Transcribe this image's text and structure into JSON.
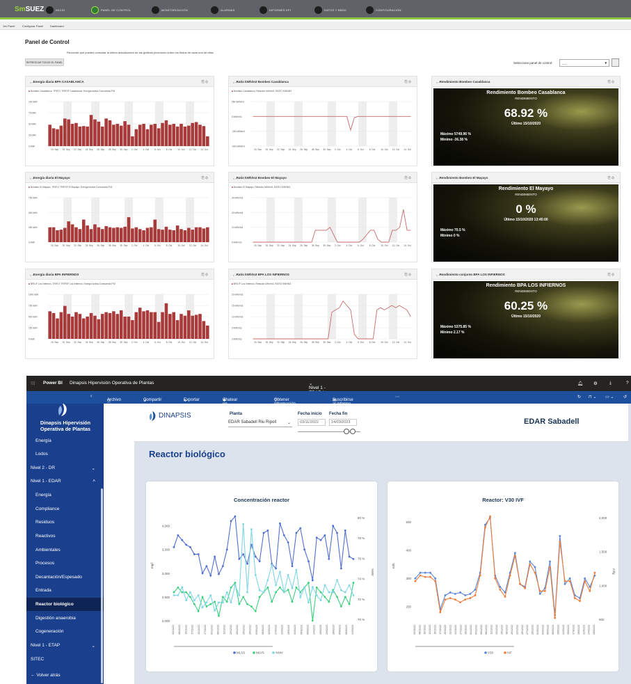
{
  "topnav": {
    "logo_a": "Sm",
    "logo_b": "SUEZ",
    "items": [
      "INICIO",
      "PANEL DE CONTROL",
      "MONITORIZACIÓN",
      "ALARMAS",
      "INFORMES KPI",
      "DATOS Y BBDD",
      "CONFIGURACIÓN"
    ]
  },
  "subnav": [
    "Ver Panel",
    "Configurar Panel",
    "Dashboard"
  ],
  "page": {
    "title": "Panel de Control",
    "info": "Recuerde que puedes consultar la última actualización de las gráficas pinchando sobre los títulos de cada una de ellas.",
    "refresh": "REFRESCAR TODOS EL PANEL",
    "select_label": "Seleccione panel de control:",
    "select_value": "-----"
  },
  "colors": {
    "bar": "#a93a3a",
    "line": "#c86a6a",
    "accent": "#8dc63f"
  },
  "panels": [
    {
      "title": ".Energía diaria BPA CASABLANCA",
      "legend": "Bombeo Casablanca. TRIFLY TRIFSF Casablanca. Energía Activa Consumida P.M"
    },
    {
      "title": ".Ratio kWh/m3 Bombeo Casablanca",
      "legend": "Bombeo Casablanca. Relación kWh/m3. RATIO KWHM3"
    },
    {
      "title": ".Rendimiento Bombeo Casablanca"
    },
    {
      "title": ".Energía diaria El Mayayo",
      "legend": "Bombeo El Mayayo. TRIFLY TRIFSF El Mayayo. Energía Activa Consumida P.M"
    },
    {
      "title": ".Ratio kWh/m3 Bombeo El Mayayo",
      "legend": "Bombeo El Mayayo. Relación kWh/m3. RATIO KWHM3"
    },
    {
      "title": ".Rendimiento Bombeo El Mayayo"
    },
    {
      "title": ".Energía diaria BPA INFIERNOS",
      "legend": "BPA IF Los Infiernos. TRIFLY TRIFSF Los Infiernos. Energía Activa Consumida P.M"
    },
    {
      "title": ".Ratio kWh/m3 BPA LOS INFIERNOS",
      "legend": "BPA IF Los Infiernos. Relación kWh/m3. RATIO KWHM3"
    },
    {
      "title": ".Rendimiento conjunto BPA LOS INFIERNOS"
    }
  ],
  "kpis": [
    {
      "title": "Rendimiento Bombeo Casablanca",
      "sub": "RENDIMIENTO",
      "value": "68.92 %",
      "ultimo": "Último 15/10/2020",
      "max": "Máximo 5749.96 %",
      "min": "Mínimo -36.38 %"
    },
    {
      "title": "Rendimiento El Mayayo",
      "sub": "RENDIMIENTO",
      "value": "0 %",
      "ultimo": "Último 15/10/2020 13:45:00",
      "max": "Máximo 70.5 %",
      "min": "Mínimo 0 %"
    },
    {
      "title": "Rendimiento BPA LOS INFIERNOS",
      "sub": "RENDIMIENTO",
      "value": "60.25 %",
      "ultimo": "Último 15/10/2020",
      "max": "Máximo 5375.85 %",
      "min": "Mínimo 2.17 %"
    }
  ],
  "small_xticks": [
    "15. Sep",
    "20. Sep",
    "22. Sep",
    "24. Sep",
    "26. Sep",
    "28. Sep",
    "30. Sep",
    "2. Oct",
    "4. Oct",
    "6. Oct",
    "8. Oct",
    "10. Oct",
    "12. Oct",
    "14. Oct"
  ],
  "small_charts": {
    "e1": {
      "yticks": [
        "100 kWh",
        "75 kWh",
        "50 kWh",
        "25 kWh",
        "0 kWh"
      ],
      "ymax": 100,
      "values": [
        48,
        40,
        38,
        46,
        62,
        60,
        50,
        52,
        44,
        45,
        44,
        70,
        60,
        55,
        44,
        62,
        58,
        48,
        50,
        46,
        56,
        48,
        22,
        38,
        48,
        50,
        38,
        48,
        50,
        40,
        52,
        58,
        48,
        50,
        44,
        50,
        44,
        46,
        52,
        54,
        48,
        45,
        22
      ]
    },
    "r1": {
      "yticks": [
        "250 kWh/m3",
        "0 kWh/m3",
        "-250 kWh/m3",
        "-500 kWh/m3"
      ],
      "ymin": -500,
      "ymax": 250,
      "values": [
        0,
        0,
        0,
        0,
        0,
        0,
        0,
        0,
        0,
        0,
        0,
        0,
        0,
        0,
        0,
        0,
        0,
        0,
        0,
        0,
        0,
        0,
        0,
        0,
        0,
        0,
        -230,
        -20,
        0,
        0,
        0,
        0,
        0,
        0,
        0,
        0,
        0,
        0,
        0,
        0,
        0,
        0,
        0
      ]
    },
    "e2": {
      "yticks": [
        "750 kWh",
        "500 kWh",
        "250 kWh",
        "0 kWh"
      ],
      "ymax": 750,
      "values": [
        250,
        250,
        200,
        210,
        240,
        350,
        300,
        250,
        220,
        380,
        280,
        220,
        300,
        250,
        220,
        270,
        250,
        240,
        250,
        240,
        260,
        420,
        230,
        250,
        220,
        200,
        240,
        250,
        380,
        220,
        210,
        260,
        210,
        200,
        280,
        220,
        200,
        240,
        210,
        250,
        250,
        230,
        250
      ]
    },
    "r2": {
      "yticks": [
        "30 kWh/m3",
        "20 kWh/m3",
        "10 kWh/m3",
        "0 kWh/m3"
      ],
      "ymax": 30,
      "values": [
        0,
        0,
        0,
        0,
        0,
        0,
        0,
        0,
        0,
        0,
        0,
        0,
        0,
        0,
        0,
        0,
        0,
        8,
        8,
        8,
        8,
        10,
        5,
        0,
        0,
        0,
        0,
        0,
        0,
        0,
        2,
        5,
        8,
        8,
        2,
        0,
        0,
        0,
        8,
        8,
        10,
        22,
        8,
        8
      ]
    },
    "e3": {
      "yticks": [
        "1000 kWh",
        "750 kWh",
        "500 kWh",
        "250 kWh",
        "0 kWh"
      ],
      "ymax": 1000,
      "values": [
        620,
        580,
        460,
        600,
        740,
        560,
        500,
        600,
        560,
        460,
        500,
        580,
        520,
        440,
        560,
        600,
        580,
        620,
        560,
        640,
        500,
        500,
        420,
        600,
        700,
        620,
        640,
        600,
        600,
        380,
        600,
        800,
        560,
        600,
        420,
        560,
        520,
        640,
        520,
        540,
        560,
        400,
        300
      ]
    },
    "r3": {
      "yticks": [
        "20 kWh/m3",
        "15 kWh/m3",
        "10 kWh/m3",
        "5 kWh/m3",
        "0 kWh/m3"
      ],
      "ymax": 20,
      "values": [
        0,
        0,
        0,
        0,
        0,
        0,
        0,
        0,
        0,
        0,
        0,
        0,
        0,
        0,
        0,
        0,
        0,
        0,
        0,
        0,
        0,
        12,
        13,
        14,
        17,
        15,
        13,
        2,
        0,
        0,
        0,
        0,
        0,
        13,
        14,
        13,
        14,
        15,
        14,
        15,
        14,
        13,
        10
      ]
    }
  },
  "pbi": {
    "app": "Power BI",
    "report": "Dinapsis Hipervisión Operativa de Plantas",
    "page_label": "Nivel 1 - EDAR  |  Datos actualizados el 14/3/23",
    "toolbar": [
      "Archivo",
      "Compartir",
      "Exportar",
      "Chatear en Teams",
      "Obtener información",
      "Suscribirse al informe"
    ],
    "sidebar_title": "Dinapsis Hipervisión Operativa de Plantas",
    "sidebar": [
      "Energía",
      "Lodos",
      "Nivel 2 - DR",
      "Nivel 1 - EDAR",
      "Energía",
      "Compliance",
      "Residuos",
      "Reactivos",
      "Ambientales",
      "Procesos",
      "Decantación/Espesado",
      "Entrada",
      "Reactor biológico",
      "Digestión anaerobia",
      "Cogeneración",
      "Nivel 1 - ETAP",
      "SITEC",
      "Volver atrás"
    ],
    "brand": "DINAPSIS",
    "planta_label": "Planta",
    "planta_value": "EDAR Sabadell Riu Ripoll",
    "fi_label": "Fecha inicio",
    "ff_label": "Fecha fin",
    "fi_value": "03/11/2022",
    "ff_value": "14/03/2023",
    "site": "EDAR Sabadell",
    "section": "Reactor biológico"
  },
  "chart_data": [
    {
      "type": "line",
      "title": "Concentración reactor",
      "ylabel": "mg/l",
      "y2label": "%MV",
      "yticks": [
        "4,000",
        "3,500",
        "3,000",
        "2,500",
        "2,000"
      ],
      "y2ticks": [
        "80 %",
        "78 %",
        "76 %",
        "74 %",
        "72 %",
        "70 %"
      ],
      "ylim": [
        2000,
        4200
      ],
      "x": [
        "03/11/22",
        "06/11/22",
        "08/11/22",
        "10/11/22",
        "13/11/22",
        "15/11/22",
        "17/11/22",
        "20/11/22",
        "22/11/22",
        "24/11/22",
        "27/11/22",
        "29/11/22",
        "01/12/22",
        "04/12/22",
        "06/12/22",
        "08/12/22",
        "11/12/22",
        "13/12/22",
        "15/12/22",
        "18/12/22",
        "20/12/22",
        "22/12/22",
        "25/12/22",
        "27/12/22",
        "29/12/22",
        "01/01/23",
        "03/01/23",
        "05/01/23",
        "08/01/23",
        "10/01/23",
        "12/01/23",
        "15/01/23",
        "17/01/23",
        "19/01/23",
        "22/01/23",
        "24/01/23",
        "26/01/23",
        "29/01/23",
        "31/01/23",
        "02/02/23",
        "05/02/23",
        "07/02/23",
        "09/02/23",
        "12/02/23",
        "14/02/23",
        "16/02/23",
        "19/02/23",
        "21/02/23",
        "23/02/23",
        "26/02/23",
        "28/02/23",
        "02/03/23",
        "05/03/23",
        "07/03/23",
        "09/03/23",
        "12/03/23",
        "14/03/23"
      ],
      "series": [
        {
          "name": "MLSS",
          "color": "#4f6fd1",
          "values": [
            3550,
            3800,
            3700,
            3600,
            3550,
            3400,
            3400,
            3000,
            3150,
            2950,
            3350,
            2980,
            3150,
            3500,
            4100,
            4200,
            3300,
            3400,
            3200,
            3600,
            3350,
            3250,
            3850,
            3900,
            3200,
            3100,
            4050,
            3800,
            3650,
            3150,
            3850,
            3950,
            3500,
            3250,
            2850,
            3750,
            3700,
            3800,
            3300,
            4000,
            3850,
            3100,
            3900,
            3350,
            3300
          ]
        },
        {
          "name": "MLVS",
          "color": "#3ccf7e",
          "values": [
            2600,
            2700,
            2600,
            2600,
            2500,
            2350,
            2200,
            2500,
            2300,
            2350,
            2400,
            2100,
            2500,
            2400,
            2700,
            2800,
            2350,
            2500,
            2350,
            2300,
            2200,
            2500,
            2600,
            2700,
            2400,
            2600,
            2700,
            2600,
            2650,
            2400,
            2700,
            2600,
            2700,
            2800,
            2000,
            2700,
            2600,
            2500,
            2400,
            2650,
            2500,
            2300,
            2500,
            2350,
            2800
          ]
        },
        {
          "name": "%MV",
          "color": "#7fd6e6",
          "values": [
            72.5,
            72.5,
            73.3,
            72.0,
            72.8,
            72.0,
            72.5,
            71.3,
            71.8,
            72.5,
            71.0,
            71.8,
            71.8,
            72.8,
            71.8,
            73.5,
            72.5,
            79.5,
            72.8,
            79.0,
            74.5,
            73.0,
            72.8,
            74.0,
            75.5,
            73.5,
            74.8,
            72.8,
            74.5,
            73.2,
            75.0,
            72.3,
            73.3,
            71.8,
            73.3,
            72.5,
            72.0,
            73.5,
            72.8,
            72.8,
            74.0,
            73.0,
            72.8,
            73.5,
            72.5
          ]
        }
      ]
    },
    {
      "type": "line",
      "title": "Reactor: V30 IVF",
      "ylabel": "ml/L",
      "y2label": "ml/g",
      "yticks": [
        "500",
        "400",
        "300",
        "200"
      ],
      "y2ticks": [
        "2,000",
        "1,500",
        "1,000",
        "500"
      ],
      "ylim": [
        150,
        520
      ],
      "x": [
        "03/11/22",
        "08/11/22",
        "10/11/22",
        "13/11/22",
        "15/11/22",
        "17/11/22",
        "20/11/22",
        "22/11/22",
        "24/11/22",
        "27/11/22",
        "29/11/22",
        "01/12/22",
        "04/12/22",
        "06/12/22",
        "08/12/22",
        "11/12/22",
        "13/12/22",
        "15/12/22",
        "18/12/22",
        "20/12/22",
        "22/12/22",
        "25/12/22",
        "27/12/22",
        "29/12/22",
        "01/01/23",
        "03/01/23",
        "05/01/23",
        "08/01/23",
        "10/01/23",
        "12/01/23",
        "15/01/23",
        "17/01/23",
        "19/01/23",
        "22/01/23",
        "24/01/23",
        "26/01/23"
      ],
      "series": [
        {
          "name": "V30",
          "color": "#5b86d8",
          "values": [
            300,
            320,
            320,
            320,
            300,
            190,
            240,
            250,
            245,
            250,
            240,
            245,
            260,
            320,
            490,
            515,
            310,
            270,
            250,
            320,
            390,
            280,
            270,
            360,
            340,
            245,
            265,
            360,
            170,
            450,
            280,
            300,
            240,
            230,
            300,
            270,
            310
          ]
        },
        {
          "name": "IVF",
          "color": "#ee7d3a",
          "values": [
            290,
            310,
            305,
            305,
            290,
            180,
            225,
            230,
            225,
            215,
            225,
            230,
            240,
            310,
            480,
            520,
            300,
            260,
            235,
            310,
            380,
            280,
            265,
            350,
            320,
            255,
            255,
            340,
            160,
            430,
            290,
            290,
            230,
            220,
            290,
            255,
            320
          ]
        }
      ]
    }
  ]
}
